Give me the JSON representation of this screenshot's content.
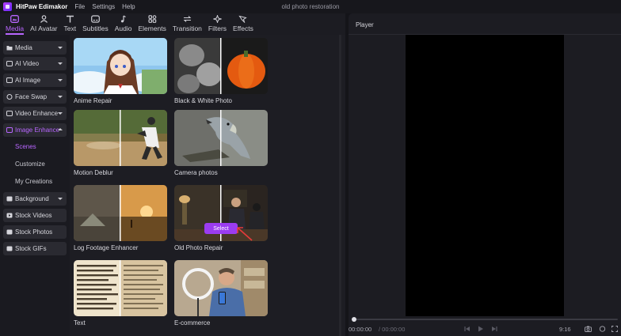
{
  "app": {
    "name": "HitPaw Edimakor",
    "document_title": "old photo restoration",
    "menu": [
      "File",
      "Settings",
      "Help"
    ]
  },
  "tabs": [
    {
      "label": "Media",
      "icon": "media-icon",
      "active": true
    },
    {
      "label": "AI Avatar",
      "icon": "avatar-icon"
    },
    {
      "label": "Text",
      "icon": "text-icon"
    },
    {
      "label": "Subtitles",
      "icon": "subtitles-icon"
    },
    {
      "label": "Audio",
      "icon": "audio-icon"
    },
    {
      "label": "Elements",
      "icon": "elements-icon"
    },
    {
      "label": "Transition",
      "icon": "transition-icon"
    },
    {
      "label": "Filters",
      "icon": "filters-icon"
    },
    {
      "label": "Effects",
      "icon": "effects-icon"
    }
  ],
  "sidebar": {
    "items": [
      {
        "label": "Media",
        "icon": "folder-icon",
        "expandable": true
      },
      {
        "label": "AI Video",
        "icon": "ai-video-icon",
        "expandable": true
      },
      {
        "label": "AI Image",
        "icon": "ai-image-icon",
        "expandable": true
      },
      {
        "label": "Face Swap",
        "icon": "face-swap-icon",
        "expandable": true
      },
      {
        "label": "Video Enhance",
        "icon": "video-enhance-icon",
        "expandable": true
      },
      {
        "label": "Image Enhance",
        "icon": "image-enhance-icon",
        "expandable": true,
        "active": true
      },
      {
        "label": "Background",
        "icon": "background-icon",
        "expandable": true
      },
      {
        "label": "Stock Videos",
        "icon": "stock-videos-icon"
      },
      {
        "label": "Stock Photos",
        "icon": "stock-photos-icon"
      },
      {
        "label": "Stock GIFs",
        "icon": "stock-gifs-icon"
      }
    ],
    "sub_items": [
      {
        "label": "Scenes",
        "active": true
      },
      {
        "label": "Customize"
      },
      {
        "label": "My Creations"
      }
    ]
  },
  "scenes": [
    {
      "label": "Anime Repair"
    },
    {
      "label": "Black & White Photo"
    },
    {
      "label": "Motion Deblur"
    },
    {
      "label": "Camera photos"
    },
    {
      "label": "Log Footage Enhancer"
    },
    {
      "label": "Old Photo Repair",
      "hover_button": "Select"
    },
    {
      "label": "Text"
    },
    {
      "label": "E-commerce"
    }
  ],
  "player": {
    "title": "Player",
    "time_current": "00:00:00",
    "time_total": "/ 00:00:00",
    "aspect_label": "9:16",
    "progress": 0
  },
  "colors": {
    "accent": "#b866ff",
    "select_button": "#9b3cf0",
    "background": "#141419",
    "panel": "#1c1c22"
  }
}
